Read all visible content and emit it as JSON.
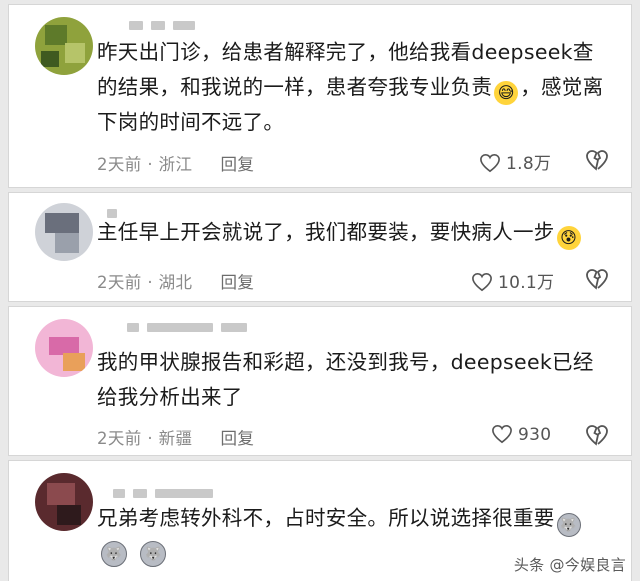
{
  "comments": [
    {
      "text_parts": [
        "昨天出门诊，给患者解释完了，他给我看deepseek查的结果，和我说的一样，患者夸我专业负责",
        "，感觉离下岗的时间不远了。"
      ],
      "emoji": "laughing-sweat-emoji",
      "time": "2天前",
      "location": "浙江",
      "reply_label": "回复",
      "likes": "1.8万"
    },
    {
      "text_parts": [
        "主任早上开会就说了，我们都要装，要快病人一步",
        ""
      ],
      "emoji": "nervous-sweat-emoji",
      "time": "2天前",
      "location": "湖北",
      "reply_label": "回复",
      "likes": "10.1万"
    },
    {
      "text_parts": [
        "我的甲状腺报告和彩超，还没到我号，deepseek已经给我分析出来了",
        ""
      ],
      "time": "2天前",
      "location": "新疆",
      "reply_label": "回复",
      "likes": "930"
    },
    {
      "text_parts": [
        "兄弟考虑转外科不，占时安全。所以说选择很重要",
        ""
      ],
      "emoji": "husky-emoji"
    }
  ],
  "watermark": "头条 @今娱良言",
  "meta_separator": " · ",
  "colors": {
    "text": "#1b1b1b",
    "meta": "#8a8a8a",
    "card": "#ffffff",
    "border": "#d6d6d6"
  }
}
